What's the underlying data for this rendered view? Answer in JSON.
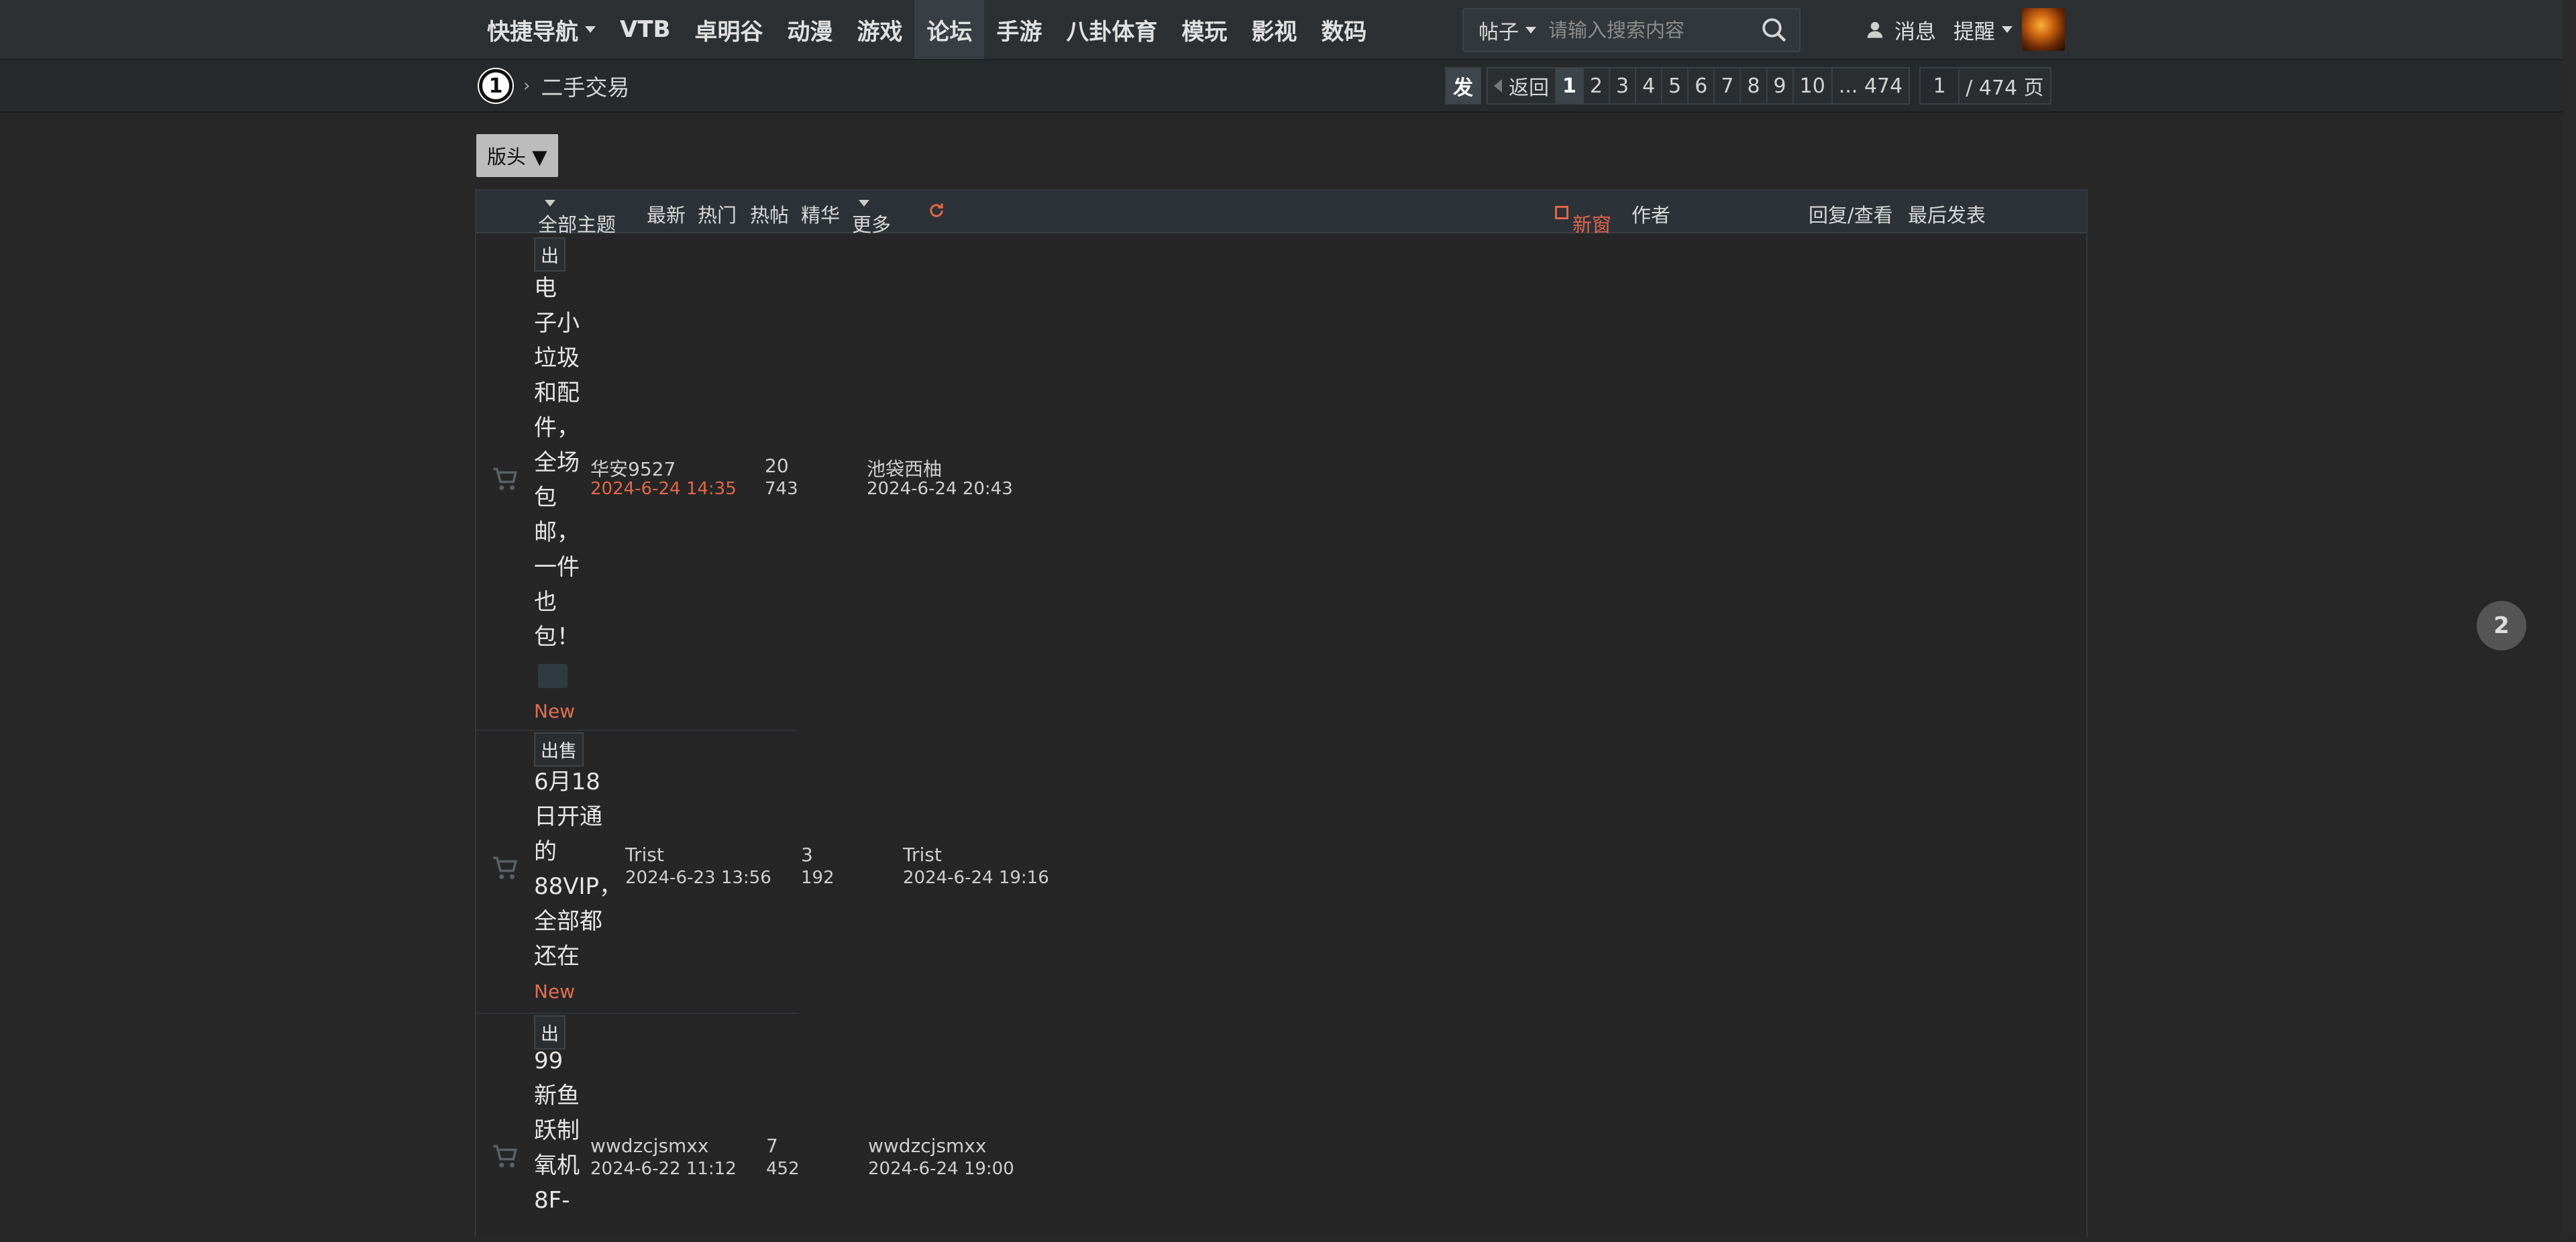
{
  "nav": {
    "items": [
      {
        "label": "快捷导航",
        "dropdown": true
      },
      {
        "label": "VTB"
      },
      {
        "label": "卓明谷"
      },
      {
        "label": "动漫"
      },
      {
        "label": "游戏"
      },
      {
        "label": "论坛",
        "active": true
      },
      {
        "label": "手游"
      },
      {
        "label": "八卦体育"
      },
      {
        "label": "模玩"
      },
      {
        "label": "影视"
      },
      {
        "label": "数码"
      }
    ],
    "search": {
      "type": "帖子",
      "placeholder": "请输入搜索内容"
    },
    "user": {
      "messages": "消息",
      "reminders": "提醒"
    }
  },
  "breadcrumb": {
    "home": "1",
    "section": "二手交易"
  },
  "pager": {
    "post": "发",
    "back": "返回",
    "pages": [
      "1",
      "2",
      "3",
      "4",
      "5",
      "6",
      "7",
      "8",
      "9",
      "10",
      "... 474"
    ],
    "current": "1",
    "input": "1",
    "total": "/ 474 页"
  },
  "head_button": "版头 ▼",
  "list_header": {
    "filter": "全部主题",
    "latest": "最新",
    "hot": "热门",
    "hotpost": "热帖",
    "digest": "精华",
    "more": "更多",
    "newwin": "新窗",
    "author": "作者",
    "replies": "回复/查看",
    "lastpost": "最后发表"
  },
  "threads": [
    {
      "tag": "出",
      "title": "出电子小垃圾和配件，全场包邮，一件也包！",
      "title_lines": [
        "电",
        "子小",
        "垃圾",
        "和配",
        "件，",
        "全场",
        "包",
        "邮，",
        "一件",
        "也",
        "包！"
      ],
      "new": "New",
      "author": "华安9527",
      "date": "2024-6-24 14:35",
      "replies": "20",
      "views": "743",
      "last_author": "池袋西柚",
      "last_date": "2024-6-24 20:43"
    },
    {
      "tag": "出售",
      "title": "6月18日开通的88VIP，全部都还在",
      "title_lines": [
        "6月18",
        "日开通",
        "的",
        "88VIP，",
        "全部都",
        "还在"
      ],
      "new": "New",
      "author": "Trist",
      "date": "2024-6-23 13:56",
      "replies": "3",
      "views": "192",
      "last_author": "Trist",
      "last_date": "2024-6-24 19:16"
    },
    {
      "tag": "出",
      "title": "99新鱼跃制氧机8F-",
      "title_lines": [
        "99",
        "新鱼",
        "跃制",
        "氧机",
        "8F-"
      ],
      "author": "wwdzcjsmxx",
      "date": "2024-6-22 11:12",
      "replies": "7",
      "views": "452",
      "last_author": "wwdzcjsmxx",
      "last_date": "2024-6-24 19:00"
    }
  ],
  "side_badge": "2",
  "colors": {
    "accent": "#e0664a",
    "bg": "#272727",
    "nav_bg": "#2c3033"
  }
}
